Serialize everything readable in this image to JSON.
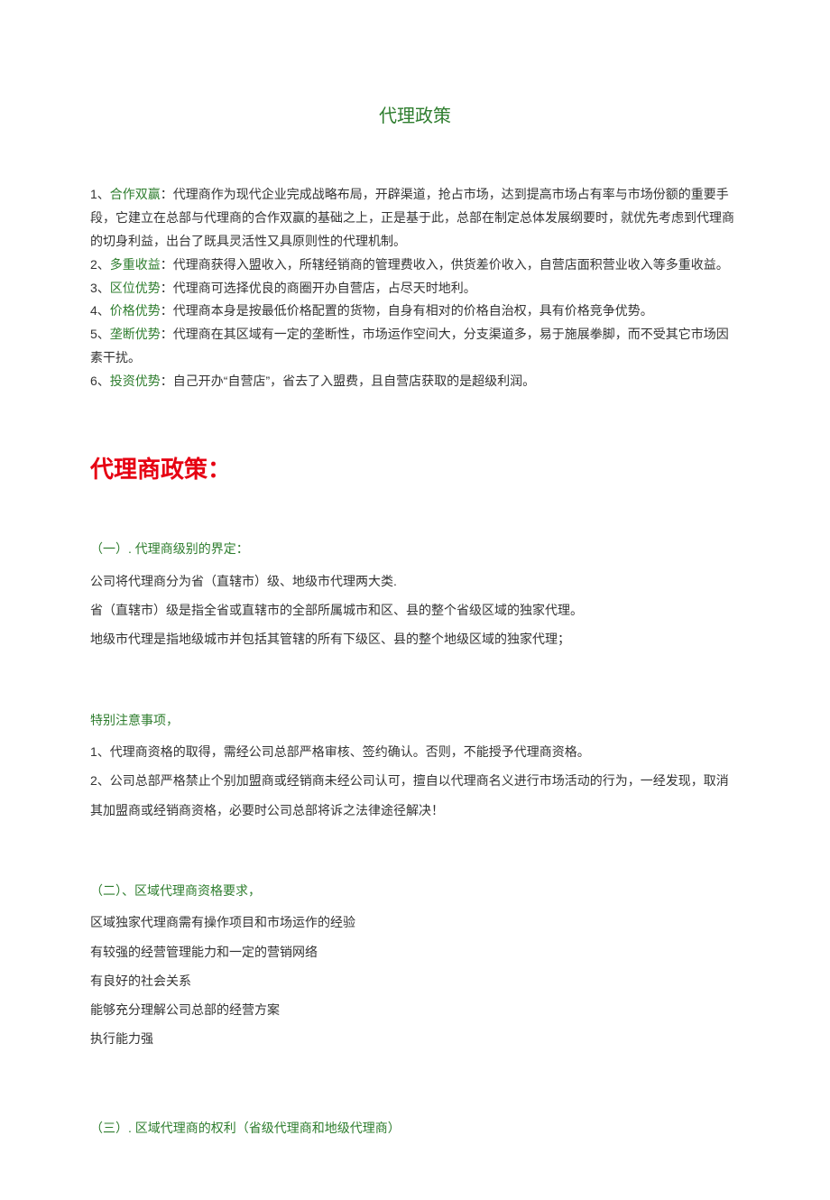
{
  "title": "代理政策",
  "intro": {
    "items": [
      {
        "idx": "1、",
        "kw": "合作双赢",
        "text": "：代理商作为现代企业完成战略布局，开辟渠道，抢占市场，达到提高市场占有率与市场份额的重要手段，它建立在总部与代理商的合作双赢的基础之上，正是基于此，总部在制定总体发展纲要时，就优先考虑到代理商的切身利益，出台了既具灵活性又具原则性的代理机制。"
      },
      {
        "idx": "2、",
        "kw": "多重收益",
        "text": "：代理商获得入盟收入，所辖经销商的管理费收入，供货差价收入，自营店面积营业收入等多重收益。"
      },
      {
        "idx": "3、",
        "kw": "区位优势",
        "text": "：代理商可选择优良的商圈开办自营店，占尽天时地利。"
      },
      {
        "idx": "4、",
        "kw": "价格优势",
        "text": "：代理商本身是按最低价格配置的货物，自身有相对的价格自治权，具有价格竞争优势。"
      },
      {
        "idx": "5、",
        "kw": "垄断优势",
        "text": "：代理商在其区域有一定的垄断性，市场运作空间大，分支渠道多，易于施展拳脚，而不受其它市场因素干扰。"
      },
      {
        "idx": "6、",
        "kw": "投资优势",
        "text": "：自己开办“自营店”，省去了入盟费，且自营店获取的是超级利润。"
      }
    ]
  },
  "policy_heading": "代理商政策：",
  "section1": {
    "heading": "（一）. 代理商级别的界定：",
    "lines": [
      "公司将代理商分为省（直辖市）级、地级市代理两大类.",
      "省（直辖市）级是指全省或直辖市的全部所属城市和区、县的整个省级区域的独家代理。",
      "地级市代理是指地级城市并包括其管辖的所有下级区、县的整个地级区域的独家代理；"
    ]
  },
  "notice": {
    "heading": "特别注意事项，",
    "lines": [
      "1、代理商资格的取得，需经公司总部严格审核、签约确认。否则，不能授予代理商资格。",
      "2、公司总部严格禁止个别加盟商或经销商未经公司认可，擅自以代理商名义进行市场活动的行为，一经发现，取消其加盟商或经销商资格，必要时公司总部将诉之法律途径解决！"
    ]
  },
  "section2": {
    "heading": "（二）、区域代理商资格要求，",
    "lines": [
      "区域独家代理商需有操作项目和市场运作的经验",
      "有较强的经营管理能力和一定的营销网络",
      "有良好的社会关系",
      "能够充分理解公司总部的经营方案",
      "执行能力强"
    ]
  },
  "section3_heading": "（三）. 区域代理商的权利（省级代理商和地级代理商）"
}
